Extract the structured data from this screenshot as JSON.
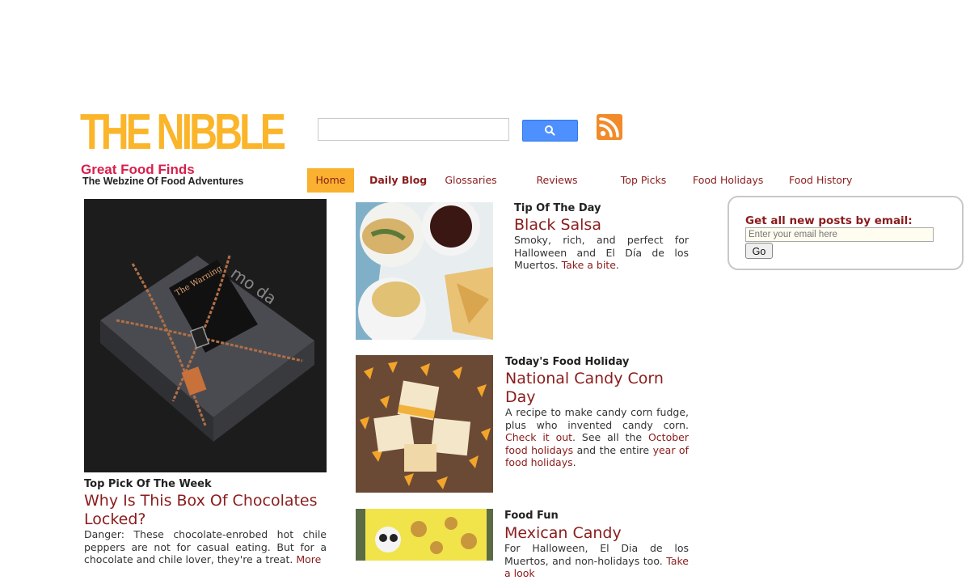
{
  "logo": {
    "title": "THE NIBBLE",
    "tagline": "Great Food Finds",
    "subtitle": "The Webzine Of Food Adventures"
  },
  "search": {
    "input_value": "",
    "button_icon": "search-icon"
  },
  "rss": {
    "icon": "rss-icon",
    "color": "#f28a2a"
  },
  "nav": {
    "items": [
      {
        "label": "Home",
        "active": true
      },
      {
        "label": "Daily Blog"
      },
      {
        "label": "Glossaries"
      },
      {
        "label": "Reviews"
      },
      {
        "label": "Top Picks"
      },
      {
        "label": "Food Holidays"
      },
      {
        "label": "Food History"
      }
    ]
  },
  "featured": {
    "kicker": "Top Pick Of The Week",
    "headline": "Why Is This Box Of Chocolates Locked?",
    "body": "Danger: These chocolate-enrobed hot chile peppers are not for casual eating. But for a chocolate and chile lover, they're a treat.",
    "link": "More"
  },
  "articles": [
    {
      "kicker": "Tip Of The Day",
      "headline": "Black Salsa",
      "body": "Smoky, rich, and perfect for Halloween and El Día de los Muertos.",
      "link": "Take a bite",
      "end": "."
    },
    {
      "kicker": "Today's Food Holiday",
      "headline": "National Candy Corn Day",
      "body_start": "A recipe to make candy corn fudge, plus who invented candy corn.",
      "link1": "Check it out",
      "mid1": ". See all the",
      "link2": "October food holidays",
      "mid2": "and the entire",
      "link3": "year of food holidays",
      "end": "."
    },
    {
      "kicker": "Food Fun",
      "headline": "Mexican Candy",
      "body": "For Halloween, El Dia de los Muertos, and non-holidays too.",
      "link": "Take a look"
    }
  ],
  "subscribe": {
    "label": "Get all new posts by email:",
    "placeholder": "Enter your email here",
    "button": "Go"
  },
  "colors": {
    "brand_yellow": "#fbb52a",
    "brand_red": "#d81f4b",
    "link_maroon": "#8a1c1c",
    "nav_active": "#f9b12f"
  }
}
